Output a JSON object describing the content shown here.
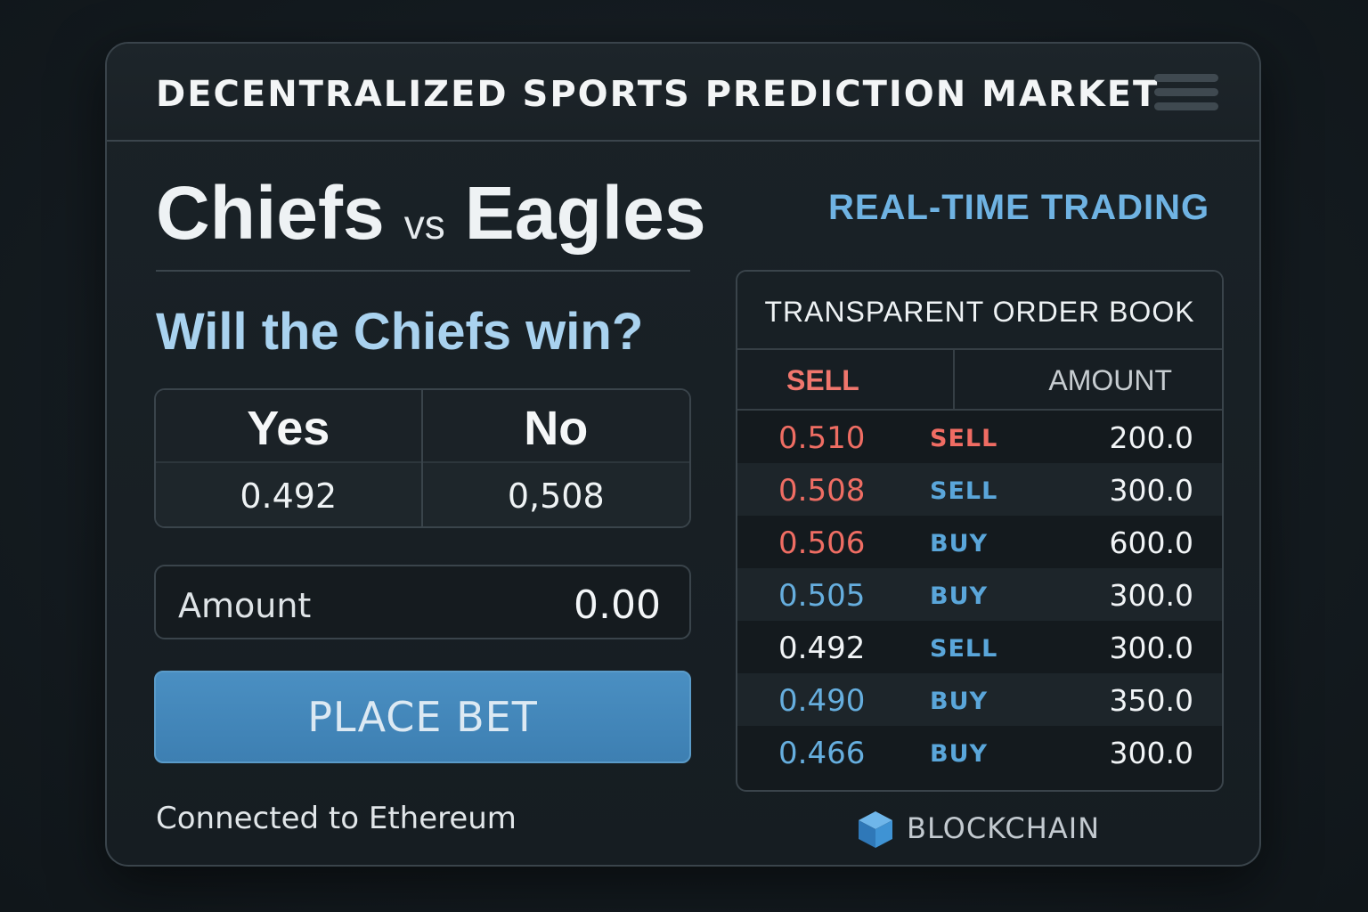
{
  "header": {
    "title": "Decentralized Sports Prediction Market"
  },
  "matchup": {
    "home": "Chiefs",
    "vs": "vs",
    "away": "Eagles"
  },
  "trading_mode": "REAL-TIME TRADING",
  "market": {
    "question": "Will the Chiefs win?",
    "outcomes": [
      {
        "label": "Yes",
        "price": "0.492"
      },
      {
        "label": "No",
        "price": "0,508"
      }
    ]
  },
  "bet_form": {
    "amount_label": "Amount",
    "amount_value": "0.00",
    "submit_label": "PLACE BET"
  },
  "connection": {
    "status": "Connected to Ethereum"
  },
  "order_book": {
    "title": "TRANSPARENT ORDER BOOK",
    "col_side": "SELL",
    "col_amount": "AMOUNT",
    "rows": [
      {
        "price": "0.510",
        "side": "SELL",
        "amount": "200.0"
      },
      {
        "price": "0.508",
        "side": "SELL",
        "amount": "300.0"
      },
      {
        "price": "0.506",
        "side": "BUY",
        "amount": "600.0"
      },
      {
        "price": "0.505",
        "side": "BUY",
        "amount": "300.0"
      },
      {
        "price": "0.492",
        "side": "SELL",
        "amount": "300.0"
      },
      {
        "price": "0.490",
        "side": "BUY",
        "amount": "350.0"
      },
      {
        "price": "0.466",
        "side": "BUY",
        "amount": "300.0"
      }
    ]
  },
  "network_badge": {
    "label": "BLOCKCHAIN",
    "icon": "cube-icon"
  },
  "colors": {
    "accent_blue": "#4a8fc2",
    "sell_red": "#ef6d63",
    "buy_blue": "#5aa6da"
  }
}
